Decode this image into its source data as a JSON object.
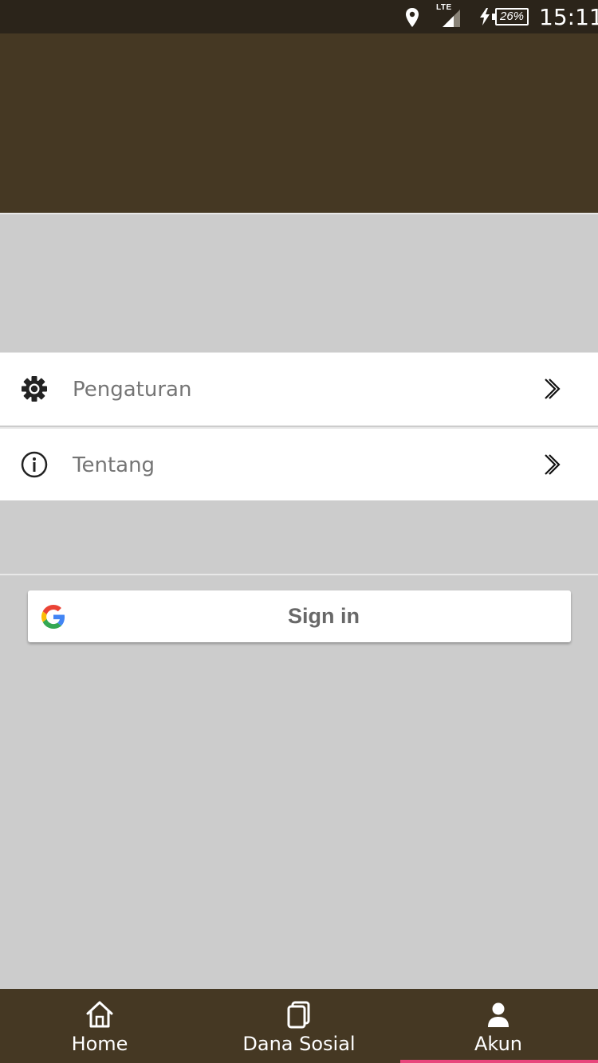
{
  "status_bar": {
    "network": "LTE",
    "battery": "26%",
    "time": "15:11"
  },
  "menu": {
    "items": [
      {
        "label": "Pengaturan",
        "icon": "gear-icon"
      },
      {
        "label": "Tentang",
        "icon": "info-icon"
      }
    ]
  },
  "signin": {
    "label": "Sign in",
    "icon": "google-icon"
  },
  "bottom_nav": {
    "items": [
      {
        "label": "Home",
        "icon": "home-icon"
      },
      {
        "label": "Dana Sosial",
        "icon": "cards-icon"
      },
      {
        "label": "Akun",
        "icon": "user-icon",
        "active": true
      }
    ],
    "active_color": "#e8467c"
  },
  "colors": {
    "header": "#453823",
    "status_bar": "#2b241a",
    "background": "#cccccc"
  }
}
